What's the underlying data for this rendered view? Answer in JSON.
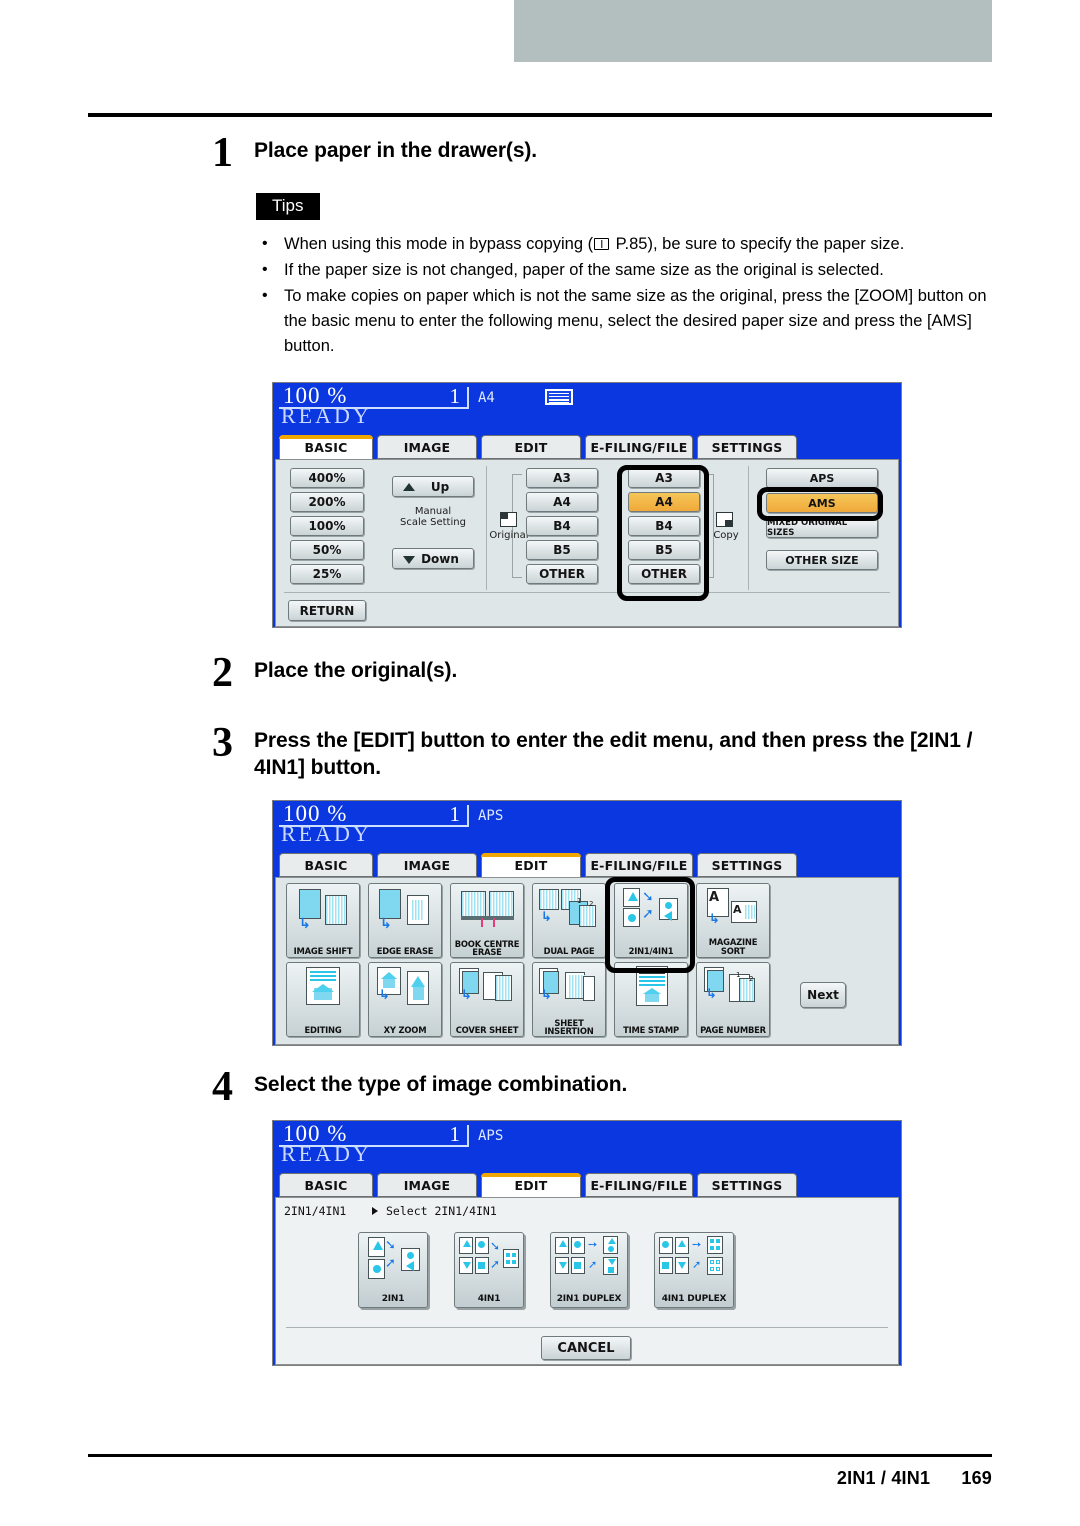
{
  "document": {
    "footer_title": "2IN1 / 4IN1",
    "page_number": "169"
  },
  "steps": [
    {
      "num": "1",
      "title": "Place paper in the drawer(s)."
    },
    {
      "num": "2",
      "title": "Place the original(s)."
    },
    {
      "num": "3",
      "title": "Press the [EDIT] button to enter the edit menu, and then press the [2IN1 / 4IN1] button."
    },
    {
      "num": "4",
      "title": "Select the type of image combination."
    }
  ],
  "tips": {
    "label": "Tips",
    "items": [
      {
        "pre": "When using this mode in bypass copying (",
        "ref": " P.85",
        "post": "), be sure to specify the paper size."
      },
      {
        "pre": "If the paper size is not changed, paper of the same size as the original is selected.",
        "ref": "",
        "post": ""
      },
      {
        "pre": "To make copies on paper which is not the same size as the original, press the [ZOOM] button on the basic menu to enter the following menu, select the desired paper size and press the [AMS] button.",
        "ref": "",
        "post": ""
      }
    ]
  },
  "panel_basic": {
    "status": {
      "ratio": "100  %",
      "copies": "1",
      "paper": "A4",
      "ready": "READY"
    },
    "tabs": [
      {
        "label": "BASIC",
        "active": true
      },
      {
        "label": "IMAGE",
        "active": false
      },
      {
        "label": "EDIT",
        "active": false
      },
      {
        "label": "E-FILING/FILE",
        "active": false
      },
      {
        "label": "SETTINGS",
        "active": false
      }
    ],
    "zoom_presets": [
      "400%",
      "200%",
      "100%",
      "50%",
      "25%"
    ],
    "manual": {
      "up": "Up",
      "down": "Down",
      "label_line1": "Manual",
      "label_line2": "Scale Setting"
    },
    "original": {
      "label": "Original",
      "sizes": [
        "A3",
        "A4",
        "B4",
        "B5",
        "OTHER"
      ],
      "selected": ""
    },
    "copy": {
      "label": "Copy",
      "sizes": [
        "A3",
        "A4",
        "B4",
        "B5",
        "OTHER"
      ],
      "selected": "A4"
    },
    "right_buttons": [
      {
        "label": "APS",
        "selected": false
      },
      {
        "label": "AMS",
        "selected": true
      },
      {
        "label": "MIXED ORIGINAL SIZES",
        "selected": false
      },
      {
        "label": "OTHER SIZE",
        "selected": false
      }
    ],
    "return_label": "RETURN",
    "highlighted": [
      "copy-size-group",
      "ams-button"
    ]
  },
  "panel_edit": {
    "status": {
      "ratio": "100  %",
      "copies": "1",
      "paper": "APS",
      "ready": "READY"
    },
    "tabs": [
      {
        "label": "BASIC",
        "active": false
      },
      {
        "label": "IMAGE",
        "active": false
      },
      {
        "label": "EDIT",
        "active": true
      },
      {
        "label": "E-FILING/FILE",
        "active": false
      },
      {
        "label": "SETTINGS",
        "active": false
      }
    ],
    "row1": [
      {
        "label": "IMAGE SHIFT",
        "icon": "image-shift-icon"
      },
      {
        "label": "EDGE ERASE",
        "icon": "edge-erase-icon"
      },
      {
        "label": "BOOK CENTRE ERASE",
        "icon": "book-centre-erase-icon"
      },
      {
        "label": "DUAL  PAGE",
        "icon": "dual-page-icon"
      },
      {
        "label": "2IN1/4IN1",
        "icon": "2in1-4in1-icon"
      },
      {
        "label": "MAGAZINE SORT",
        "icon": "magazine-sort-icon"
      }
    ],
    "row2": [
      {
        "label": "EDITING",
        "icon": "editing-icon"
      },
      {
        "label": "XY ZOOM",
        "icon": "xy-zoom-icon"
      },
      {
        "label": "COVER SHEET",
        "icon": "cover-sheet-icon"
      },
      {
        "label": "SHEET INSERTION",
        "icon": "sheet-insertion-icon"
      },
      {
        "label": "TIME STAMP",
        "icon": "time-stamp-icon"
      },
      {
        "label": "PAGE NUMBER",
        "icon": "page-number-icon"
      }
    ],
    "next_label": "Next",
    "highlighted": "2IN1/4IN1"
  },
  "panel_combine": {
    "status": {
      "ratio": "100  %",
      "copies": "1",
      "paper": "APS",
      "ready": "READY"
    },
    "tabs": [
      {
        "label": "BASIC",
        "active": false
      },
      {
        "label": "IMAGE",
        "active": false
      },
      {
        "label": "EDIT",
        "active": true
      },
      {
        "label": "E-FILING/FILE",
        "active": false
      },
      {
        "label": "SETTINGS",
        "active": false
      }
    ],
    "breadcrumb_left": "2IN1/4IN1",
    "breadcrumb_right": "Select 2IN1/4IN1",
    "options": [
      {
        "label": "2IN1"
      },
      {
        "label": "4IN1"
      },
      {
        "label": "2IN1 DUPLEX"
      },
      {
        "label": "4IN1 DUPLEX"
      }
    ],
    "cancel_label": "CANCEL"
  },
  "colors": {
    "lcd_blue": "#0b37e0",
    "lcd_body": "#dfe6e8",
    "accent_orange": "#f0a800",
    "selected_amber": "#f3b44a",
    "header_gray": "#b3bfbf",
    "icon_cyan": "#7fd8ef",
    "arrow_blue": "#1878e8"
  }
}
